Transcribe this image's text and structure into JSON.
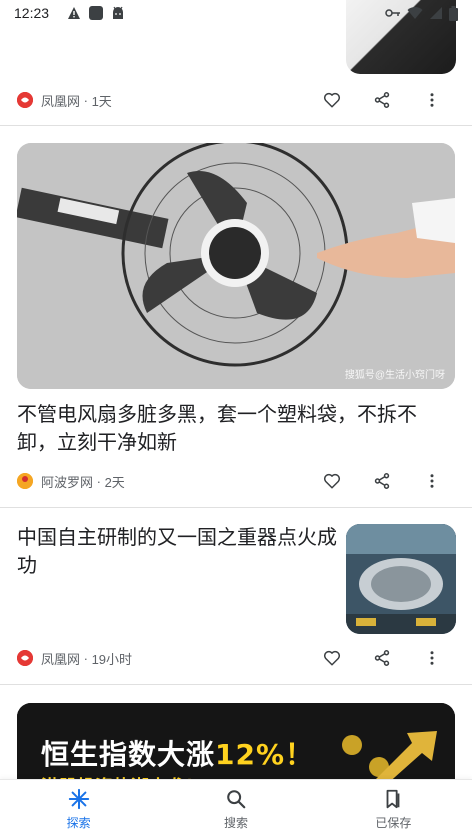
{
  "status_bar": {
    "time": "12:23",
    "left_icons": [
      "warning-icon",
      "app-icon",
      "android-icon"
    ],
    "right_icons": [
      "key-icon",
      "wifi-icon",
      "signal-icon",
      "battery-icon"
    ]
  },
  "feed": {
    "cards": [
      {
        "source": "凤凰网",
        "time": "1天",
        "source_color": "#e53935"
      },
      {
        "title": "不管电风扇多脏多黑，套一个塑料袋，不拆不卸，立刻干净如新",
        "image_caption": "搜狐号@生活小窍门呀",
        "source": "阿波罗网",
        "time": "2天",
        "source_color": "#f5a623"
      },
      {
        "title": "中国自主研制的又一国之重器点火成功",
        "source": "凤凰网",
        "time": "19小时",
        "source_color": "#e53935"
      },
      {
        "banner_text": "恒生指数大涨",
        "banner_pct": "12%！",
        "banner_sub": "港股投资热潮来袭！"
      }
    ]
  },
  "bottom_nav": {
    "items": [
      {
        "label": "探索",
        "icon": "explore-asterisk-icon",
        "active": true
      },
      {
        "label": "搜索",
        "icon": "search-icon",
        "active": false
      },
      {
        "label": "已保存",
        "icon": "bookmark-icon",
        "active": false
      }
    ]
  },
  "colors": {
    "accent": "#1a73e8",
    "text": "#202124",
    "meta": "#5f6368"
  }
}
